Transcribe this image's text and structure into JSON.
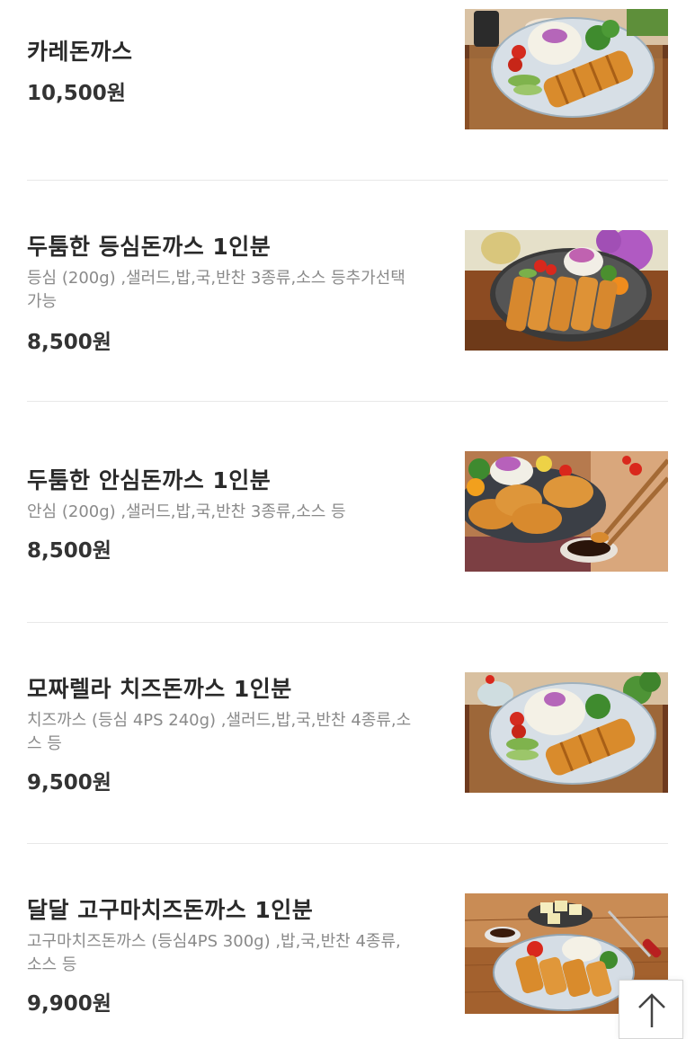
{
  "menu": {
    "items": [
      {
        "name": "카레돈까스",
        "description": "",
        "price": "10,500원"
      },
      {
        "name": "두툼한 등심돈까스 1인분",
        "description": "등심 (200g) ,샐러드,밥,국,반찬 3종류,소스 등추가선택가능",
        "price": "8,500원"
      },
      {
        "name": "두툼한 안심돈까스 1인분",
        "description": "안심 (200g) ,샐러드,밥,국,반찬 3종류,소스 등",
        "price": "8,500원"
      },
      {
        "name": "모짜렐라 치즈돈까스 1인분",
        "description": "치즈까스 (등심 4PS 240g) ,샐러드,밥,국,반찬 4종류,소스 등",
        "price": "9,500원"
      },
      {
        "name": "달달 고구마치즈돈까스 1인분",
        "description": "고구마치즈돈까스 (등심4PS 300g) ,밥,국,반찬 4종류,소스 등",
        "price": "9,900원"
      }
    ]
  },
  "scroll_top": {
    "icon": "arrow-up-icon"
  }
}
